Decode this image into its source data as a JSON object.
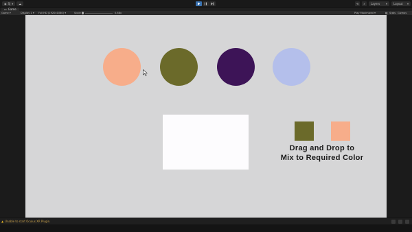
{
  "toolbar": {
    "account_label": "SJ",
    "layers_label": "Layers",
    "layout_label": "Layout"
  },
  "tab": {
    "title": "Game"
  },
  "gamebar": {
    "mode_label": "Game",
    "display_label": "Display 1",
    "resolution_label": "Full HD (1920x1080)",
    "scale_label": "Scale",
    "scale_value": "0.88x",
    "play_mode_label": "Play Maximized",
    "stats_label": "Stats",
    "gizmos_label": "Gizmos"
  },
  "game": {
    "circles": [
      {
        "name": "peach",
        "color": "#f7ad8a"
      },
      {
        "name": "olive",
        "color": "#6b6a2a"
      },
      {
        "name": "purple",
        "color": "#3d1457"
      },
      {
        "name": "lavender",
        "color": "#b4bfeb"
      }
    ],
    "mix_area_color": "#fdfcfe",
    "target_swatches": [
      {
        "color": "#6b6a2a"
      },
      {
        "color": "#f7ad8a"
      }
    ],
    "instruction_line1": "Drag and Drop to",
    "instruction_line2": "Mix to Required Color"
  },
  "status": {
    "warning_text": "Unable to start Oculus XR Plugin."
  }
}
